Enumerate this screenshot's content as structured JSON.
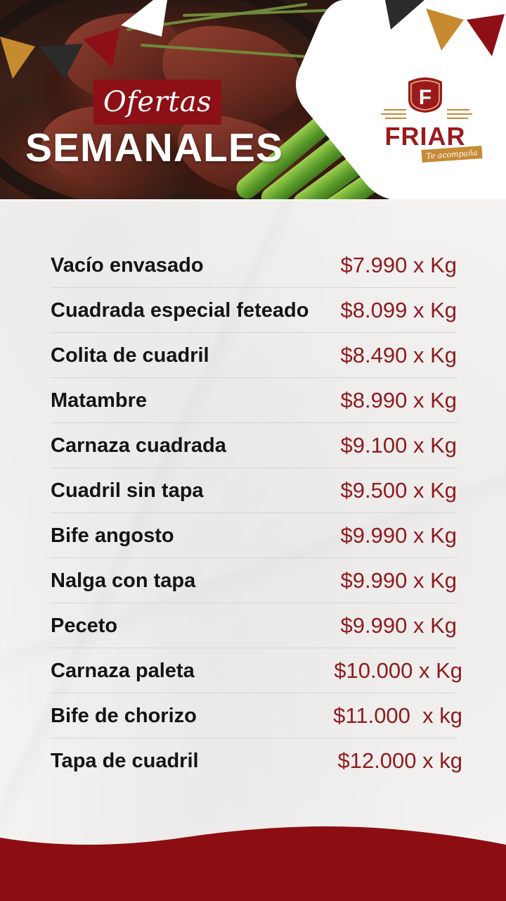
{
  "header": {
    "ofertas_label": "Ofertas",
    "semanales_label": "SEMANALES"
  },
  "logo": {
    "badge_letter": "F",
    "brand": "FRIAR",
    "tagline": "Te acompaña"
  },
  "colors": {
    "brand_red": "#8c1016",
    "price_red": "#8e1b1f",
    "gold": "#c58b35",
    "flag_dark": "#2b2b2b"
  },
  "items": [
    {
      "name": "Vacío envasado",
      "price": "$7.990 x Kg"
    },
    {
      "name": "Cuadrada especial feteado",
      "price": "$8.099 x Kg"
    },
    {
      "name": "Colita de cuadril",
      "price": "$8.490 x Kg"
    },
    {
      "name": "Matambre",
      "price": "$8.990 x Kg"
    },
    {
      "name": "Carnaza cuadrada",
      "price": "$9.100 x Kg"
    },
    {
      "name": "Cuadril sin tapa",
      "price": "$9.500 x Kg"
    },
    {
      "name": "Bife angosto",
      "price": "$9.990 x Kg"
    },
    {
      "name": "Nalga con tapa",
      "price": "$9.990 x Kg"
    },
    {
      "name": "Peceto",
      "price": "$9.990 x Kg"
    },
    {
      "name": "Carnaza paleta",
      "price": "$10.000 x Kg"
    },
    {
      "name": "Bife de chorizo",
      "price": "$11.000  x kg"
    },
    {
      "name": "Tapa de cuadril",
      "price": "$12.000 x kg"
    }
  ]
}
